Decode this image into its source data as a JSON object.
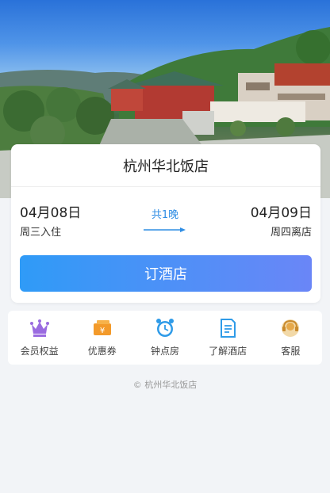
{
  "hotel": {
    "name": "杭州华北饭店"
  },
  "stay": {
    "checkin_date": "04月08日",
    "checkin_label": "周三入住",
    "checkout_date": "04月09日",
    "checkout_label": "周四离店",
    "nights_label": "共1晚"
  },
  "actions": {
    "book_label": "订酒店"
  },
  "quick_links": [
    {
      "label": "会员权益",
      "icon": "crown-icon",
      "color": "#9a6be0"
    },
    {
      "label": "优惠券",
      "icon": "coupon-icon",
      "color": "#f39a2a"
    },
    {
      "label": "钟点房",
      "icon": "alarm-clock-icon",
      "color": "#2f9be8"
    },
    {
      "label": "了解酒店",
      "icon": "document-icon",
      "color": "#2f9be8"
    },
    {
      "label": "客服",
      "icon": "headset-icon",
      "color": "#e6a94a"
    }
  ],
  "footer": {
    "copyright": "© 杭州华北饭店"
  }
}
